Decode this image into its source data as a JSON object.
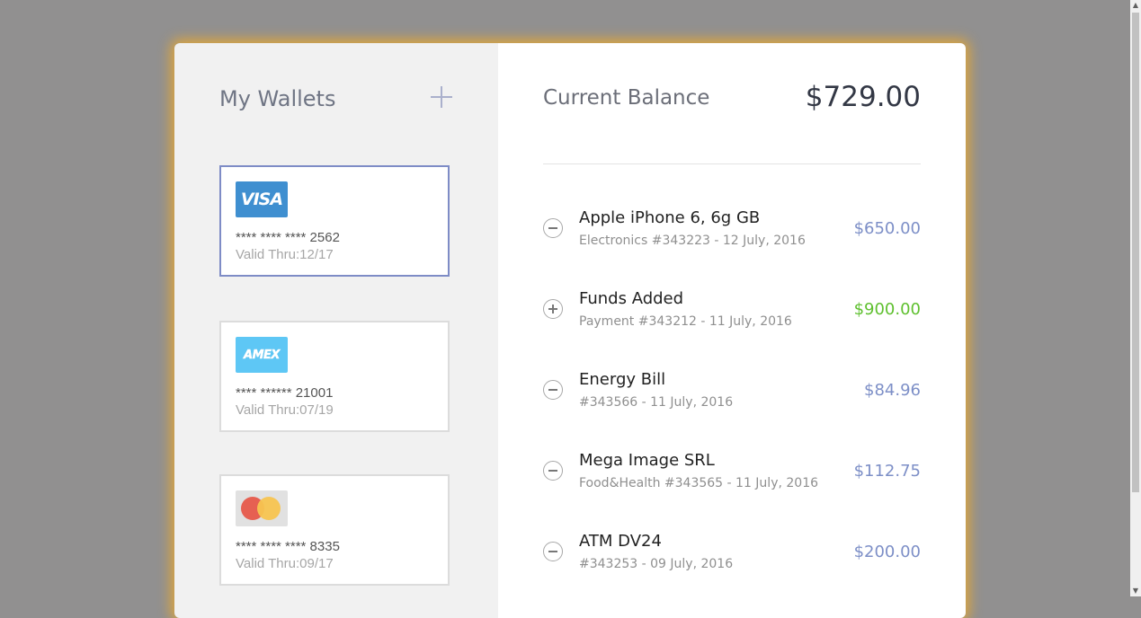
{
  "wallets": {
    "title": "My Wallets",
    "add_icon": "plus-icon",
    "cards": [
      {
        "brand": "VISA",
        "number": "**** **** **** 2562",
        "valid": "Valid Thru:12/17",
        "active": true
      },
      {
        "brand": "AMEX",
        "number": "**** ****** 21001",
        "valid": "Valid Thru:07/19",
        "active": false
      },
      {
        "brand": "mastercard",
        "number": "**** **** **** 8335",
        "valid": "Valid Thru:09/17",
        "active": false
      }
    ]
  },
  "balance": {
    "label": "Current Balance",
    "value": "$729.00"
  },
  "transactions": [
    {
      "type": "minus",
      "title": "Apple iPhone 6, 6g GB",
      "subtitle": "Electronics #343223 - 12 July, 2016",
      "amount": "$650.00"
    },
    {
      "type": "plus",
      "title": "Funds Added",
      "subtitle": "Payment #343212 - 11 July, 2016",
      "amount": "$900.00"
    },
    {
      "type": "minus",
      "title": "Energy Bill",
      "subtitle": "#343566 - 11 July, 2016",
      "amount": "$84.96"
    },
    {
      "type": "minus",
      "title": "Mega Image SRL",
      "subtitle": "Food&Health #343565 - 11 July, 2016",
      "amount": "$112.75"
    },
    {
      "type": "minus",
      "title": "ATM DV24",
      "subtitle": "#343253 - 09 July, 2016",
      "amount": "$200.00"
    }
  ],
  "colors": {
    "accent": "#7e8cc6",
    "positive": "#5fc02f",
    "negative": "#7d8fc7",
    "glow": "#f0aa28"
  }
}
